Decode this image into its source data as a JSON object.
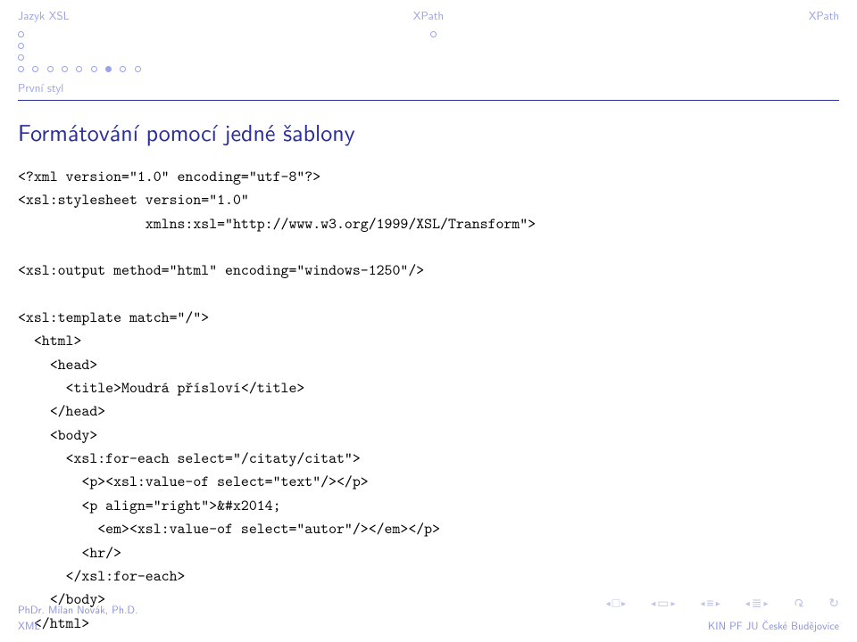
{
  "header": {
    "left": "Jazyk XSL",
    "center": "XPath",
    "right": "XPath"
  },
  "subsection": "První styl",
  "title": "Formátování pomocí jedné šablony",
  "code": "<?xml version=\"1.0\" encoding=\"utf-8\"?>\n<xsl:stylesheet version=\"1.0\"\n                xmlns:xsl=\"http://www.w3.org/1999/XSL/Transform\">\n\n<xsl:output method=\"html\" encoding=\"windows-1250\"/>\n\n<xsl:template match=\"/\">\n  <html>\n    <head>\n      <title>Moudrá přísloví</title>\n    </head>\n    <body>\n      <xsl:for-each select=\"/citaty/citat\">\n        <p><xsl:value-of select=\"text\"/></p>\n        <p align=\"right\">&#x2014;\n          <em><xsl:value-of select=\"autor\"/></em></p>\n        <hr/>\n      </xsl:for-each>\n    </body>\n  </html>",
  "footer": {
    "left": "PhDr. Milan Novák, Ph.D.",
    "right": "KIN PF JU České Budějovice",
    "bottom": "XML"
  }
}
